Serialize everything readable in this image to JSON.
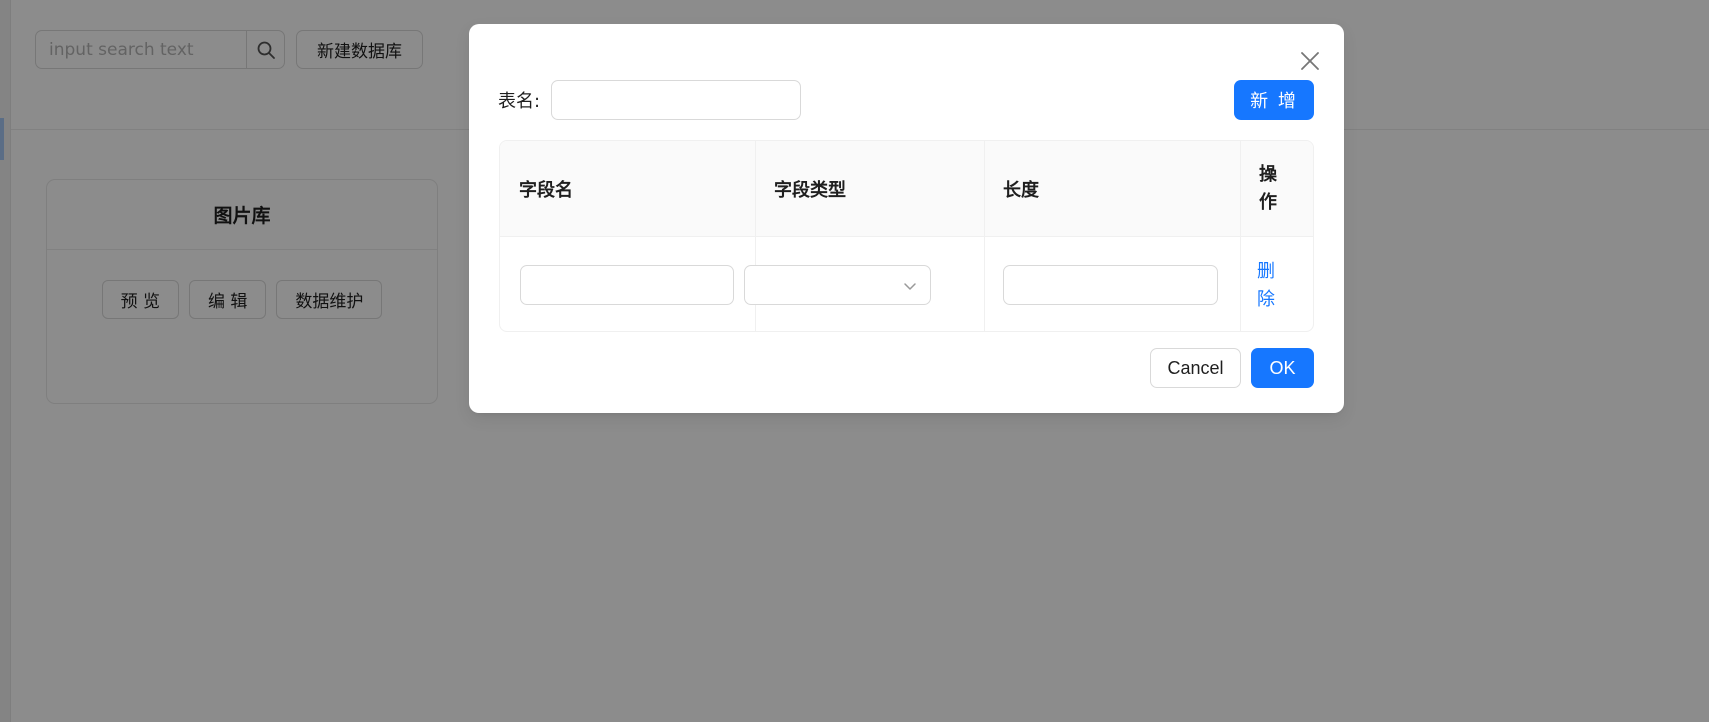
{
  "background": {
    "search": {
      "placeholder": "input search text",
      "icon": "search-icon"
    },
    "new_database_label": "新建数据库",
    "card": {
      "title": "图片库",
      "actions": [
        "预 览",
        "编 辑",
        "数据维护"
      ]
    }
  },
  "modal": {
    "close_icon": "close-icon",
    "table_name_label": "表名:",
    "table_name_value": "",
    "add_label": "新 增",
    "columns": [
      "字段名",
      "字段类型",
      "长度",
      "操作"
    ],
    "row": {
      "field_name": "",
      "field_type": "",
      "length": "",
      "action_label": "删除"
    },
    "cancel_label": "Cancel",
    "ok_label": "OK"
  },
  "colors": {
    "primary": "#1677ff",
    "mask": "rgba(0,0,0,0.45)"
  }
}
